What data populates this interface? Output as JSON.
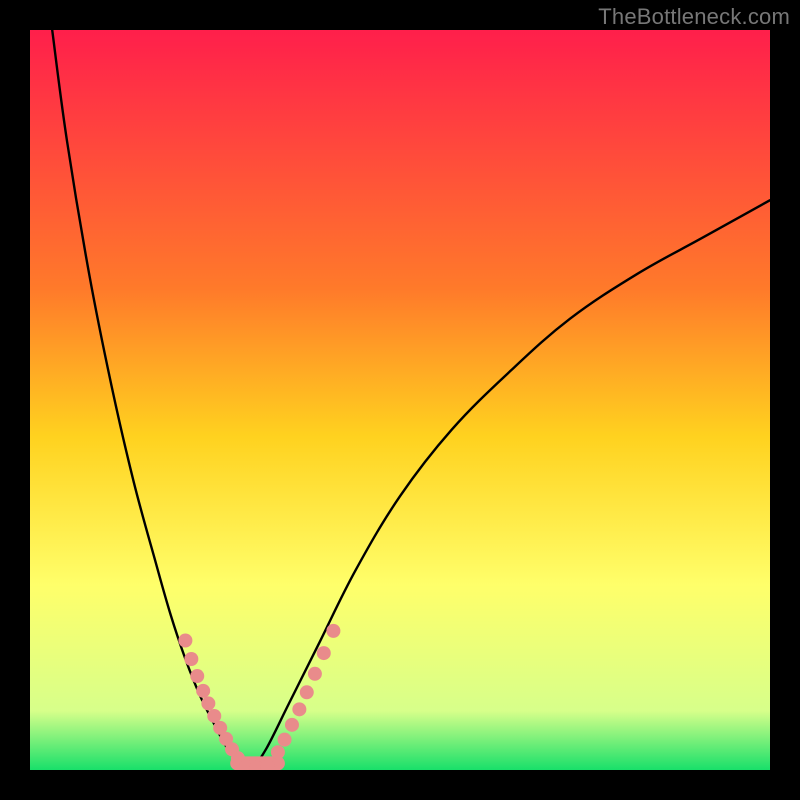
{
  "watermark": "TheBottleneck.com",
  "chart_data": {
    "type": "line",
    "title": "",
    "xlabel": "",
    "ylabel": "",
    "xlim": [
      0,
      100
    ],
    "ylim": [
      0,
      100
    ],
    "gradient_stops": [
      {
        "offset": 0,
        "color": "#ff1f4b"
      },
      {
        "offset": 35,
        "color": "#ff7a2a"
      },
      {
        "offset": 55,
        "color": "#ffd21f"
      },
      {
        "offset": 75,
        "color": "#ffff6a"
      },
      {
        "offset": 92,
        "color": "#d7ff8a"
      },
      {
        "offset": 100,
        "color": "#18e06a"
      }
    ],
    "series": [
      {
        "name": "left-branch",
        "x": [
          3,
          5,
          8,
          11,
          14,
          17,
          19,
          21,
          23,
          25,
          26.5,
          28,
          29,
          30
        ],
        "y": [
          100,
          85,
          67,
          52,
          39,
          28,
          21,
          15,
          10,
          6,
          3.2,
          1.4,
          0.5,
          0
        ]
      },
      {
        "name": "right-branch",
        "x": [
          30,
          32,
          35,
          39,
          44,
          50,
          57,
          65,
          73,
          82,
          91,
          100
        ],
        "y": [
          0,
          3,
          9,
          17,
          27,
          37,
          46,
          54,
          61,
          67,
          72,
          77
        ]
      }
    ],
    "plateau": {
      "x_start": 28,
      "x_end": 33.5,
      "y": 0
    },
    "markers": {
      "color": "#e98b8b",
      "radius": 7,
      "left": [
        {
          "x": 21.0,
          "y": 17.5
        },
        {
          "x": 21.8,
          "y": 15.0
        },
        {
          "x": 22.6,
          "y": 12.7
        },
        {
          "x": 23.4,
          "y": 10.7
        },
        {
          "x": 24.1,
          "y": 9.0
        },
        {
          "x": 24.9,
          "y": 7.3
        },
        {
          "x": 25.7,
          "y": 5.7
        },
        {
          "x": 26.5,
          "y": 4.2
        },
        {
          "x": 27.3,
          "y": 2.8
        },
        {
          "x": 28.1,
          "y": 1.6
        }
      ],
      "right": [
        {
          "x": 33.5,
          "y": 2.4
        },
        {
          "x": 34.4,
          "y": 4.1
        },
        {
          "x": 35.4,
          "y": 6.1
        },
        {
          "x": 36.4,
          "y": 8.2
        },
        {
          "x": 37.4,
          "y": 10.5
        },
        {
          "x": 38.5,
          "y": 13.0
        },
        {
          "x": 39.7,
          "y": 15.8
        },
        {
          "x": 41.0,
          "y": 18.8
        }
      ],
      "bottom": [
        {
          "x": 29.2,
          "y": 0.45
        },
        {
          "x": 30.6,
          "y": 0.35
        },
        {
          "x": 32.1,
          "y": 0.45
        }
      ]
    }
  }
}
